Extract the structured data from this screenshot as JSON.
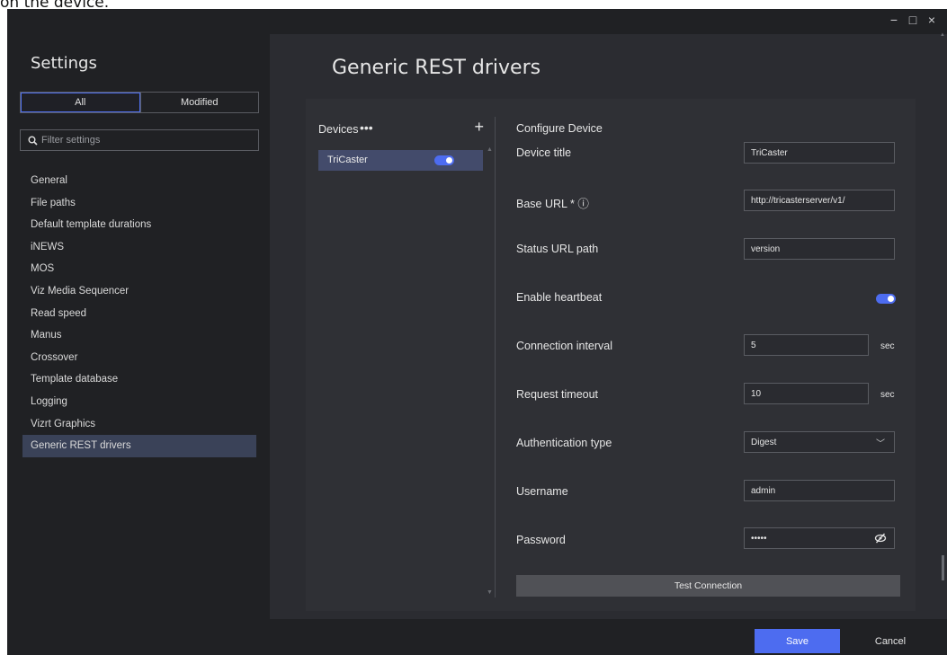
{
  "caption": "on the device.",
  "window_controls": {
    "minimize": "−",
    "maximize": "□",
    "close": "×"
  },
  "sidebar": {
    "title": "Settings",
    "tabs": {
      "all": "All",
      "modified": "Modified"
    },
    "filter_placeholder": "Filter settings",
    "items": [
      "General",
      "File paths",
      "Default template durations",
      "iNEWS",
      "MOS",
      "Viz Media Sequencer",
      "Read speed",
      "Manus",
      "Crossover",
      "Template database",
      "Logging",
      "Vizrt Graphics",
      "Generic REST drivers"
    ],
    "selected": "Generic REST drivers"
  },
  "main": {
    "title": "Generic REST drivers",
    "devices": {
      "label": "Devices",
      "menu_glyph": "•••",
      "add_glyph": "+",
      "list": [
        {
          "name": "TriCaster",
          "enabled": true
        }
      ]
    },
    "configure": {
      "title": "Configure Device",
      "device_title_label": "Device title",
      "device_title_value": "TriCaster",
      "base_url_label": "Base URL * ⓘ",
      "base_url_value": "http://tricasterserver/v1/",
      "status_url_label": "Status URL path",
      "status_url_value": "version",
      "heartbeat_label": "Enable heartbeat",
      "heartbeat_enabled": true,
      "connection_interval_label": "Connection interval",
      "connection_interval_value": "5",
      "connection_interval_unit": "sec",
      "request_timeout_label": "Request timeout",
      "request_timeout_value": "10",
      "request_timeout_unit": "sec",
      "auth_type_label": "Authentication type",
      "auth_type_value": "Digest",
      "username_label": "Username",
      "username_value": "admin",
      "password_label": "Password",
      "password_value": "•••••",
      "test_button": "Test Connection"
    }
  },
  "footer": {
    "save": "Save",
    "cancel": "Cancel"
  },
  "colors": {
    "accent": "#4d6cf0",
    "selected_bg": "#3a4258",
    "panel_bg": "#2b2c31"
  }
}
